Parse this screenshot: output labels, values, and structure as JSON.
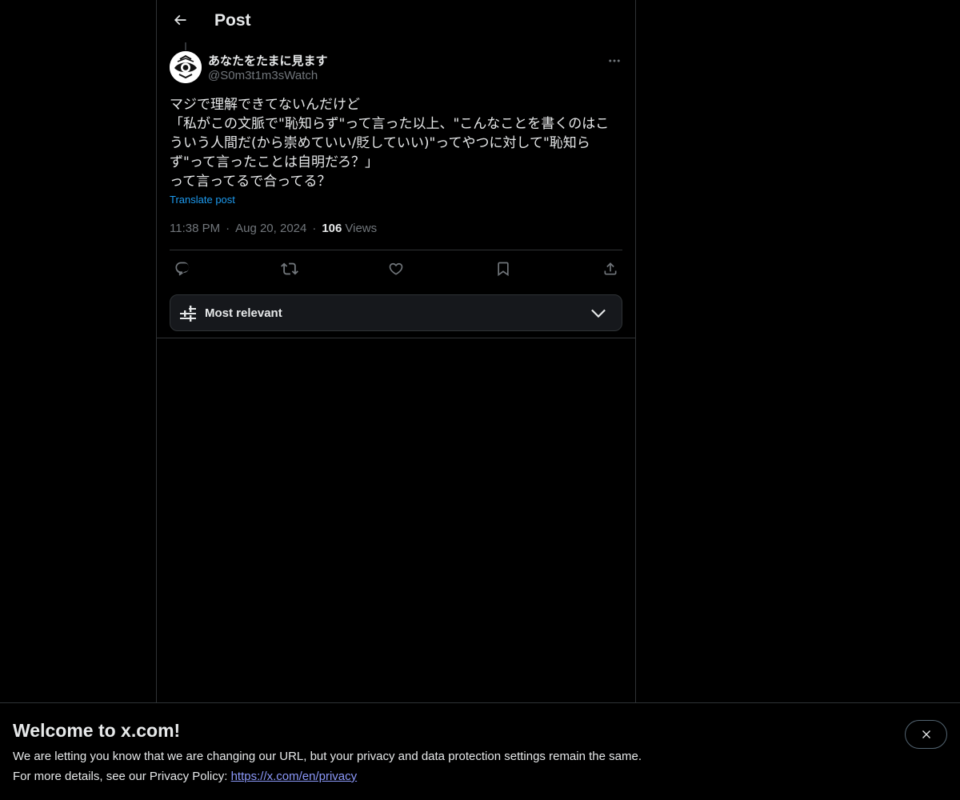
{
  "header": {
    "back_icon": "arrow-left-icon",
    "title": "Post"
  },
  "post": {
    "author": {
      "display_name": "あなたをたまに見ます",
      "handle": "@S0m3t1m3sWatch",
      "avatar_icon": "eye-emblem-avatar"
    },
    "more_icon": "more-horizontal-icon",
    "text": "マジで理解できてないんだけど\n「私がこの文脈で\"恥知らず\"って言った以上、\"こんなことを書くのはこ\nういう人間だ(から崇めていい/貶していい)\"ってやつに対して\"恥知ら\nず\"って言ったことは自明だろ？」\nって言ってるで合ってる？",
    "translate_label": "Translate post",
    "time": "11:38 PM",
    "separator": "·",
    "date": "Aug 20, 2024",
    "views_count": "106",
    "views_label": "Views"
  },
  "actions": [
    {
      "name": "reply",
      "icon": "reply-icon"
    },
    {
      "name": "repost",
      "icon": "repost-icon"
    },
    {
      "name": "like",
      "icon": "heart-icon"
    },
    {
      "name": "bookmark",
      "icon": "bookmark-icon"
    },
    {
      "name": "share",
      "icon": "share-icon"
    }
  ],
  "sort": {
    "icon": "sliders-icon",
    "label": "Most relevant",
    "chevron_icon": "chevron-down-icon"
  },
  "banner": {
    "title": "Welcome to x.com!",
    "line1": "We are letting you know that we are changing our URL, but your privacy and data protection settings remain the same.",
    "line2_prefix": "For more details, see our Privacy Policy: ",
    "link": "https://x.com/en/privacy",
    "close_icon": "close-icon"
  },
  "colors": {
    "background": "#000000",
    "text_primary": "#e7e9ea",
    "text_secondary": "#71767b",
    "accent": "#1d9bf0",
    "border": "#2f3336",
    "link_banner": "#8b98f9"
  }
}
